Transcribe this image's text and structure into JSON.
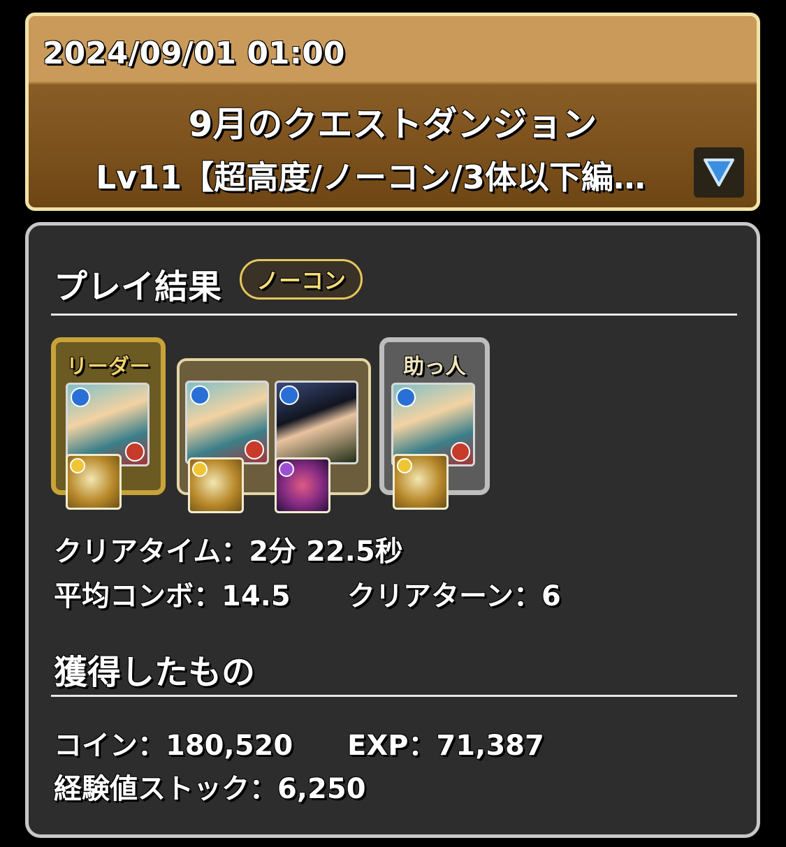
{
  "header": {
    "datetime": "2024/09/01 01:00",
    "title": "9月のクエストダンジョン",
    "subtitle": "Lv11【超高度/ノーコン/3体以下編…"
  },
  "result": {
    "section_title": "プレイ結果",
    "badge": "ノーコン",
    "leader_label": "リーダー",
    "helper_label": "助っ人",
    "clear_time": "クリアタイム：2分 22.5秒",
    "avg_combo": "平均コンボ：14.5",
    "clear_turns": "クリアターン：6"
  },
  "rewards": {
    "section_title": "獲得したもの",
    "coins": "コイン：180,520",
    "exp": "EXP：71,387",
    "exp_stock": "経験値ストック：6,250"
  },
  "colors": {
    "header_top": "#c99a5a",
    "header_bottom": "#6e4614",
    "panel_bg": "#2d2d2d",
    "leader_frame": "#c8a338",
    "badge_border": "#e6c75a"
  },
  "icons": [
    "dropdown-triangle-icon",
    "water-attribute-icon",
    "fire-attribute-icon",
    "light-attribute-icon",
    "dark-attribute-icon"
  ]
}
